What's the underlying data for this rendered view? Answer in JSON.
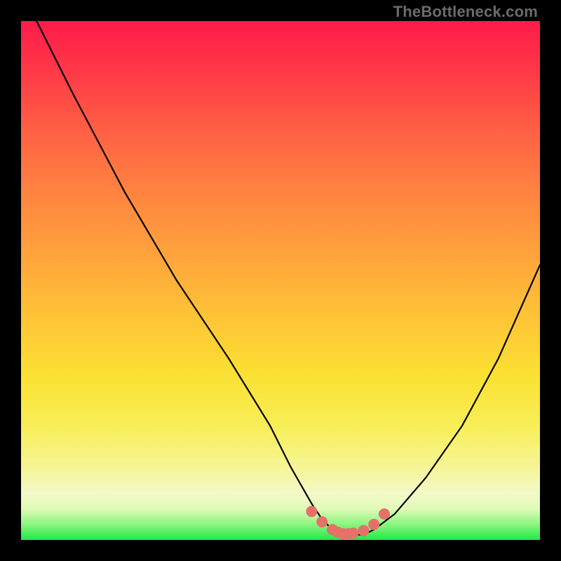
{
  "watermark": "TheBottleneck.com",
  "chart_data": {
    "type": "line",
    "title": "",
    "xlabel": "",
    "ylabel": "",
    "xlim": [
      0,
      100
    ],
    "ylim": [
      0,
      100
    ],
    "series": [
      {
        "name": "curve",
        "x": [
          3,
          10,
          20,
          30,
          40,
          48,
          52,
          56,
          58,
          60,
          62,
          64,
          66,
          68,
          72,
          78,
          85,
          92,
          100
        ],
        "values": [
          100,
          86,
          67,
          50,
          35,
          22,
          14,
          7,
          4,
          2,
          1,
          1,
          1,
          2,
          5,
          12,
          22,
          35,
          53
        ]
      }
    ],
    "highlight_points": {
      "name": "flat-bottom-markers",
      "x": [
        56,
        58,
        60,
        61,
        62,
        63,
        64,
        66,
        68,
        70
      ],
      "values": [
        5.5,
        3.5,
        2.0,
        1.5,
        1.2,
        1.2,
        1.3,
        1.8,
        3.0,
        5.0
      ]
    },
    "background": {
      "type": "vertical-gradient",
      "stops": [
        {
          "pos": 0,
          "color": "#ff1b4a"
        },
        {
          "pos": 45,
          "color": "#ffa33c"
        },
        {
          "pos": 78,
          "color": "#f8ee57"
        },
        {
          "pos": 100,
          "color": "#1eea46"
        }
      ]
    },
    "marker_color": "#e77068"
  }
}
